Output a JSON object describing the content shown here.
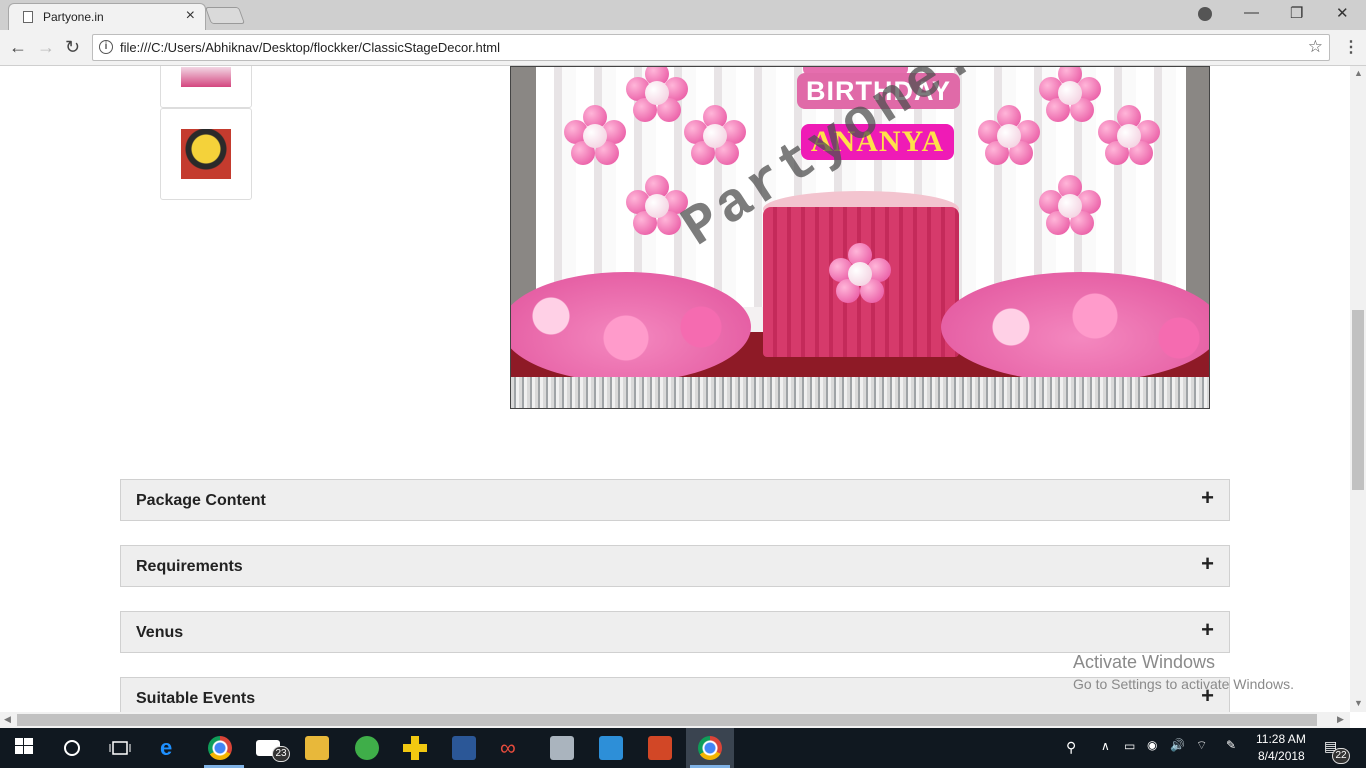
{
  "browser": {
    "tab_title": "Partyone.in",
    "tab_close": "×",
    "url": "file:///C:/Users/Abhiknav/Desktop/flockker/ClassicStageDecor.html",
    "info_glyph": "i",
    "back": "←",
    "forward": "→",
    "reload": "↻",
    "star": "☆",
    "menu": "⋮",
    "minimize": "—",
    "maximize": "❐",
    "close": "✕"
  },
  "hero": {
    "banner_line": "BIRTHDAY",
    "name": "ANANYA",
    "watermark": "Partyone.in"
  },
  "accordion": {
    "items": [
      {
        "label": "Package Content",
        "toggle": "+"
      },
      {
        "label": "Requirements",
        "toggle": "+"
      },
      {
        "label": "Venus",
        "toggle": "+"
      },
      {
        "label": "Suitable Events",
        "toggle": "+"
      }
    ]
  },
  "activation": {
    "title": "Activate Windows",
    "subtitle": "Go to Settings to activate Windows."
  },
  "taskbar": {
    "mail_badge": "23",
    "time": "11:28 AM",
    "date": "8/4/2018",
    "notification_badge": "22"
  },
  "colors": {
    "accent_pink": "#e06aa8",
    "name_banner": "#ef1bb6",
    "taskbar": "#101820"
  }
}
